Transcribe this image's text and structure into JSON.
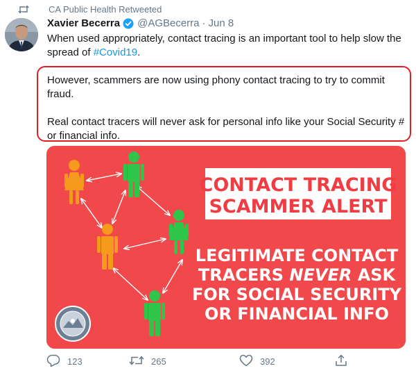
{
  "retweet_context": {
    "label": "CA Public Health Retweeted",
    "icon": "retweet-icon"
  },
  "tweet": {
    "author_name": "Xavier Becerra",
    "handle": "@AGBecerra",
    "separator": "·",
    "date": "Jun 8",
    "verified": true,
    "text_lead": "When used appropriately, contact tracing is an important tool to help slow the spread of ",
    "hashtag": "#Covid19",
    "text_tail": ".",
    "highlight_para1": "However, scammers are now using phony contact tracing to try to commit fraud.",
    "highlight_para2": "Real contact tracers will never ask for personal info like your Social Security # or financial info."
  },
  "media": {
    "background_color": "#f1484c",
    "headline_line1": "CONTACT TRACING",
    "headline_line2": "SCAMMER ALERT",
    "body_line1": "LEGITIMATE CONTACT",
    "body_line2_pre": "TRACERS ",
    "body_line2_emph": "NEVER",
    "body_line2_post": " ASK",
    "body_line3": "FOR SOCIAL SECURITY",
    "body_line4": "OR FINANCIAL INFO",
    "person_colors": {
      "orange": "#f59a1c",
      "green": "#2fc44a"
    },
    "seal_icon": "state-seal-icon"
  },
  "actions": {
    "reply_count": "123",
    "retweet_count": "265",
    "like_count": "392",
    "share_icon": "share-icon"
  },
  "colors": {
    "accent": "#1b95e0",
    "highlight_border": "#e01e25",
    "muted": "#657786"
  }
}
